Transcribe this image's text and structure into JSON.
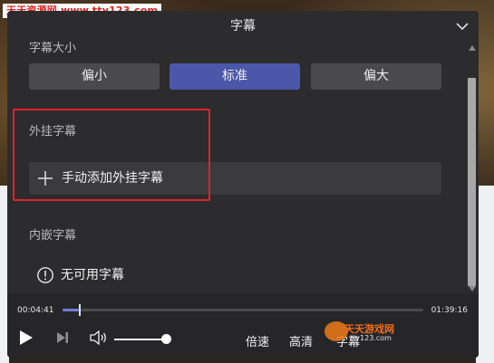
{
  "watermark_top": "天天资源网 www.tty123.com",
  "panel": {
    "title": "字幕",
    "partial_section_title": "字幕大小"
  },
  "size_options": [
    {
      "label": "偏小",
      "selected": false
    },
    {
      "label": "标准",
      "selected": true
    },
    {
      "label": "偏大",
      "selected": false
    }
  ],
  "external_subtitles": {
    "title": "外挂字幕",
    "add_label": "手动添加外挂字幕"
  },
  "embedded_subtitles": {
    "title": "内嵌字幕",
    "none_label": "无可用字幕"
  },
  "player": {
    "current_time": "00:04:41",
    "total_time": "01:39:16",
    "progress_fraction": 0.047,
    "volume_fraction": 1.0,
    "speed_label": "倍速",
    "quality_label": "高清",
    "subtitle_label": "字幕"
  },
  "logo_watermark": {
    "line1": "天天游戏网",
    "line2": "tty123.com"
  },
  "colors": {
    "accent": "#4b57a8",
    "highlight_box": "#e0232b",
    "panel_bg": "#2c2c2e"
  }
}
